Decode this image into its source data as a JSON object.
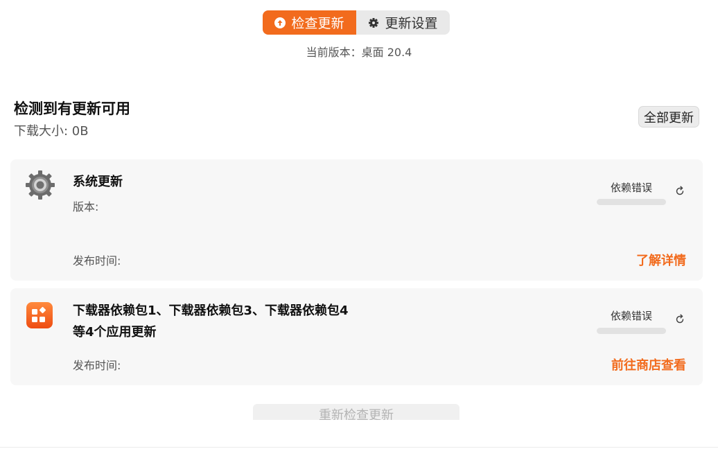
{
  "tabs": {
    "check_update": "检查更新",
    "update_settings": "更新设置"
  },
  "current_version": "当前版本：桌面 20.4",
  "summary": {
    "title": "检测到有更新可用",
    "download_size": "下载大小: 0B",
    "update_all": "全部更新"
  },
  "items": [
    {
      "icon": "settings-gear-icon",
      "title": "系统更新",
      "version_label": "版本:",
      "release_label": "发布时间:",
      "status": "依赖错误",
      "progress": 0,
      "link": "了解详情"
    },
    {
      "icon": "app-store-icon",
      "title": "下载器依赖包1、下载器依赖包3、下载器依赖包4等4个应用更新",
      "release_label": "发布时间:",
      "status": "依赖错误",
      "progress": 0,
      "link": "前往商店查看"
    }
  ],
  "recheck": "重新检查更新",
  "colors": {
    "accent": "#f26b1d",
    "card_bg": "#f7f7f7"
  }
}
